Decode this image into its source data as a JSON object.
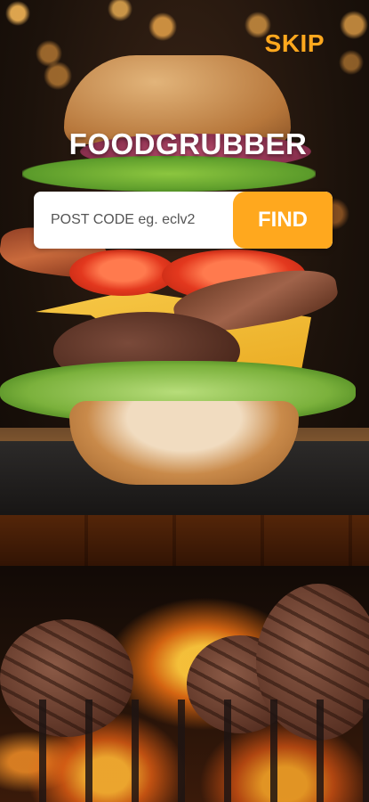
{
  "header": {
    "skip_label": "SKIP",
    "app_title": "FOODGRUBBER"
  },
  "search": {
    "placeholder": "POST CODE eg. eclv2",
    "value": "",
    "button_label": "FIND"
  },
  "theme": {
    "accent": "#ffa81e",
    "title_color": "#ffffff",
    "input_background": "#ffffff"
  },
  "images": {
    "hero": "stacked-burger-photo",
    "footer": "patties-on-flaming-grill-photo"
  }
}
